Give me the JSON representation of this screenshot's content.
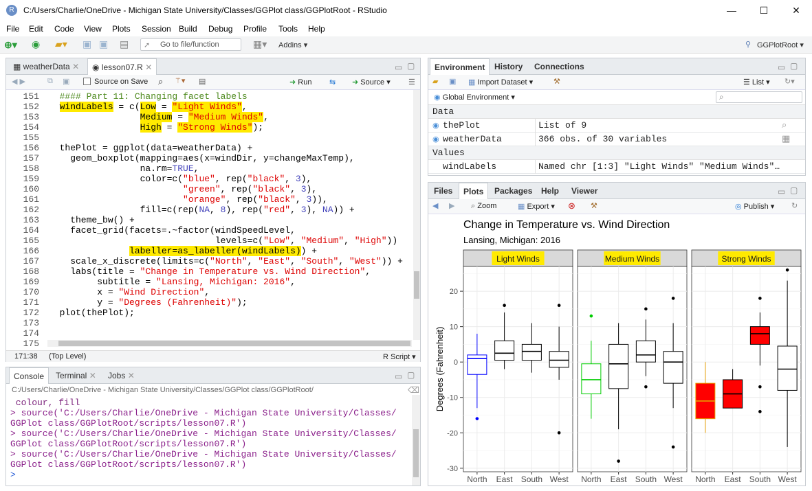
{
  "window": {
    "title": "C:/Users/Charlie/OneDrive - Michigan State University/Classes/GGPlot class/GGPlotRoot - RStudio",
    "icon_letter": "R",
    "minimize": "—",
    "maximize": "☐",
    "close": "✕"
  },
  "menu": [
    "File",
    "Edit",
    "Code",
    "View",
    "Plots",
    "Session",
    "Build",
    "Debug",
    "Profile",
    "Tools",
    "Help"
  ],
  "toolbar": {
    "goto_placeholder": "Go to file/function",
    "addins": "Addins",
    "project": "GGPlotRoot"
  },
  "editor": {
    "tabs": [
      "weatherData",
      "lesson07.R"
    ],
    "source_on_save": "Source on Save",
    "run": "Run",
    "source": "Source",
    "status_pos": "171:38",
    "status_scope": "(Top Level)",
    "status_type": "R Script",
    "lines": [
      {
        "n": "151",
        "t": "  #### Part 11: Changing facet labels"
      },
      {
        "n": "152",
        "t": "  windLabels = c(Low = \"Light Winds\","
      },
      {
        "n": "153",
        "t": "                 Medium = \"Medium Winds\","
      },
      {
        "n": "154",
        "t": "                 High = \"Strong Winds\");"
      },
      {
        "n": "155",
        "t": ""
      },
      {
        "n": "156",
        "t": "  thePlot = ggplot(data=weatherData) +"
      },
      {
        "n": "157",
        "t": "    geom_boxplot(mapping=aes(x=windDir, y=changeMaxTemp),"
      },
      {
        "n": "158",
        "t": "                 na.rm=TRUE,"
      },
      {
        "n": "159",
        "t": "                 color=c(\"blue\", rep(\"black\", 3),"
      },
      {
        "n": "160",
        "t": "                         \"green\", rep(\"black\", 3),"
      },
      {
        "n": "161",
        "t": "                         \"orange\", rep(\"black\", 3)),"
      },
      {
        "n": "162",
        "t": "                 fill=c(rep(NA, 8), rep(\"red\", 3), NA)) +"
      },
      {
        "n": "163",
        "t": "    theme_bw() +"
      },
      {
        "n": "164",
        "t": "    facet_grid(facets=.~factor(windSpeedLevel,"
      },
      {
        "n": "165",
        "t": "                               levels=c(\"Low\", \"Medium\", \"High\"))"
      },
      {
        "n": "166",
        "t": "               labeller=as_labeller(windLabels)) +"
      },
      {
        "n": "167",
        "t": "    scale_x_discrete(limits=c(\"North\", \"East\", \"South\", \"West\")) +"
      },
      {
        "n": "168",
        "t": "    labs(title = \"Change in Temperature vs. Wind Direction\","
      },
      {
        "n": "169",
        "t": "         subtitle = \"Lansing, Michigan: 2016\","
      },
      {
        "n": "170",
        "t": "         x = \"Wind Direction\","
      },
      {
        "n": "171",
        "t": "         y = \"Degrees (Fahrenheit)\");"
      },
      {
        "n": "172",
        "t": "  plot(thePlot);"
      },
      {
        "n": "173",
        "t": ""
      },
      {
        "n": "174",
        "t": ""
      },
      {
        "n": "175",
        "t": ""
      }
    ]
  },
  "console": {
    "tabs": [
      "Console",
      "Terminal",
      "Jobs"
    ],
    "path": "C:/Users/Charlie/OneDrive - Michigan State University/Classes/GGPlot class/GGPlotRoot/",
    "lines": [
      " colour, fill",
      "> source('C:/Users/Charlie/OneDrive - Michigan State University/Classes/",
      "GGPlot class/GGPlotRoot/scripts/lesson07.R')",
      "> source('C:/Users/Charlie/OneDrive - Michigan State University/Classes/",
      "GGPlot class/GGPlotRoot/scripts/lesson07.R')",
      "> source('C:/Users/Charlie/OneDrive - Michigan State University/Classes/",
      "GGPlot class/GGPlotRoot/scripts/lesson07.R')",
      "> "
    ]
  },
  "environment": {
    "tabs": [
      "Environment",
      "History",
      "Connections"
    ],
    "import_dataset": "Import Dataset",
    "list": "List",
    "global_env": "Global Environment",
    "data_header": "Data",
    "values_header": "Values",
    "data_rows": [
      {
        "name": "thePlot",
        "value": "List of 9"
      },
      {
        "name": "weatherData",
        "value": "366 obs. of 30 variables"
      }
    ],
    "value_rows": [
      {
        "name": "windLabels",
        "value": "Named chr [1:3] \"Light Winds\" \"Medium Winds\"…"
      }
    ]
  },
  "files": {
    "tabs": [
      "Files",
      "Plots",
      "Packages",
      "Help",
      "Viewer"
    ],
    "zoom": "Zoom",
    "export": "Export",
    "publish": "Publish"
  },
  "chart_data": {
    "type": "boxplot",
    "title": "Change in Temperature vs. Wind Direction",
    "subtitle": "Lansing, Michigan: 2016",
    "xlabel": "Wind Direction",
    "ylabel": "Degrees (Fahrenheit)",
    "ylim": [
      -30,
      25
    ],
    "yticks": [
      20,
      10,
      0,
      -10,
      -20,
      -30
    ],
    "categories": [
      "North",
      "East",
      "South",
      "West"
    ],
    "facets": [
      {
        "label": "Light Winds",
        "boxes": [
          {
            "cat": "North",
            "q1": -3.5,
            "median": 1,
            "q3": 2,
            "lo": -13,
            "hi": 8,
            "outliers": [
              -16
            ],
            "stroke": "#0000ff",
            "fill": "none"
          },
          {
            "cat": "East",
            "q1": 0.5,
            "median": 2.5,
            "q3": 6,
            "lo": -2,
            "hi": 14,
            "outliers": [
              16
            ],
            "stroke": "#000000",
            "fill": "none"
          },
          {
            "cat": "South",
            "q1": 0.5,
            "median": 3,
            "q3": 5,
            "lo": -3,
            "hi": 11,
            "outliers": [],
            "stroke": "#000000",
            "fill": "none"
          },
          {
            "cat": "West",
            "q1": -1.5,
            "median": 0.5,
            "q3": 3,
            "lo": -5,
            "hi": 10,
            "outliers": [
              16,
              -20
            ],
            "stroke": "#000000",
            "fill": "none"
          }
        ]
      },
      {
        "label": "Medium Winds",
        "boxes": [
          {
            "cat": "North",
            "q1": -9,
            "median": -5,
            "q3": -0.5,
            "lo": -16,
            "hi": 6,
            "outliers": [
              13
            ],
            "stroke": "#00cc00",
            "fill": "none"
          },
          {
            "cat": "East",
            "q1": -7.5,
            "median": -0.5,
            "q3": 5,
            "lo": -19,
            "hi": 11,
            "outliers": [
              -28
            ],
            "stroke": "#000000",
            "fill": "none"
          },
          {
            "cat": "South",
            "q1": 0,
            "median": 2,
            "q3": 6,
            "lo": -4,
            "hi": 12,
            "outliers": [
              15,
              -7
            ],
            "stroke": "#000000",
            "fill": "none"
          },
          {
            "cat": "West",
            "q1": -6,
            "median": 0,
            "q3": 3,
            "lo": -13,
            "hi": 11,
            "outliers": [
              18,
              -24
            ],
            "stroke": "#000000",
            "fill": "none"
          }
        ]
      },
      {
        "label": "Strong Winds",
        "boxes": [
          {
            "cat": "North",
            "q1": -16,
            "median": -11,
            "q3": -6,
            "lo": -20,
            "hi": 0,
            "outliers": [],
            "stroke": "#e69f00",
            "fill": "#ff0000"
          },
          {
            "cat": "East",
            "q1": -13,
            "median": -9,
            "q3": -5,
            "lo": -13,
            "hi": -2,
            "outliers": [],
            "stroke": "#000000",
            "fill": "#ff0000"
          },
          {
            "cat": "South",
            "q1": 5,
            "median": 8,
            "q3": 10,
            "lo": -1,
            "hi": 14,
            "outliers": [
              18,
              -7,
              -14
            ],
            "stroke": "#000000",
            "fill": "#ff0000"
          },
          {
            "cat": "West",
            "q1": -8,
            "median": -2,
            "q3": 4.5,
            "lo": -24,
            "hi": 23,
            "outliers": [
              26
            ],
            "stroke": "#000000",
            "fill": "none"
          }
        ]
      }
    ],
    "highlight_color": "#ffea00",
    "grid": true
  }
}
